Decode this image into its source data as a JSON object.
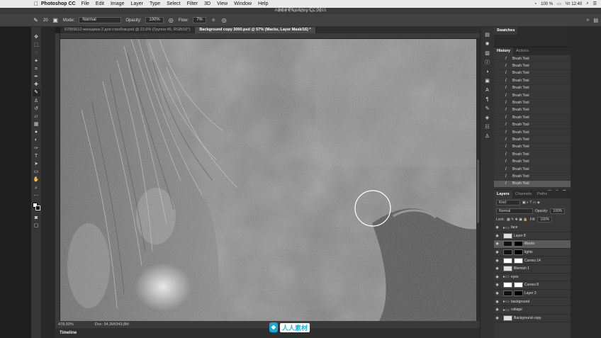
{
  "menubar": {
    "app": "Photoshop CC",
    "items": [
      "File",
      "Edit",
      "Image",
      "Layer",
      "Type",
      "Select",
      "Filter",
      "3D",
      "View",
      "Window",
      "Help"
    ],
    "battery": "100 %",
    "clock": "Чт 12:40"
  },
  "window_title": "Adobe Photoshop CC 2015",
  "options": {
    "brush_size": "20",
    "mode_label": "Mode:",
    "mode_value": "Normal",
    "opacity_label": "Opacity:",
    "opacity_value": "100%",
    "flow_label": "Flow:",
    "flow_value": "7%"
  },
  "tabs": [
    {
      "label": "67069612-женщина-3 для стиобов.psd @ 22,6% (Группа 45, RGB/16*)",
      "active": false
    },
    {
      "label": "Background copy 3000.psd @ 57% (Macks, Layer Mask/16) *",
      "active": true
    }
  ],
  "status": {
    "zoom": "478,93%",
    "doc": "Doc: 34,3M/343,8M"
  },
  "timeline_label": "Timeline",
  "watermark": {
    "top": "RRCG.CN",
    "text": "人人素材"
  },
  "panels": {
    "swatches_tab": "Swatches",
    "history_tabs": [
      "History",
      "Actions"
    ],
    "history_items": [
      "Brush Tool",
      "Brush Tool",
      "Brush Tool",
      "Brush Tool",
      "Brush Tool",
      "Brush Tool",
      "Brush Tool",
      "Brush Tool",
      "Brush Tool",
      "Brush Tool",
      "Brush Tool",
      "Brush Tool",
      "Brush Tool",
      "Brush Tool",
      "Brush Tool",
      "Brush Tool",
      "Brush Tool",
      "Brush Tool"
    ],
    "layers_tabs": [
      "Layers",
      "Channels",
      "Paths"
    ],
    "kind_label": "Kind",
    "blend_mode": "Normal",
    "opacity_label": "Opacity:",
    "opacity_value": "100%",
    "lock_label": "Lock:",
    "fill_label": "Fill:",
    "fill_value": "100%",
    "layers": [
      {
        "name": "face",
        "kind": "folder",
        "active": false
      },
      {
        "name": "Layer 8",
        "kind": "layer",
        "active": false
      },
      {
        "name": "Macks",
        "kind": "mask",
        "active": true
      },
      {
        "name": "lights",
        "kind": "mask",
        "active": false
      },
      {
        "name": "Curves 14",
        "kind": "adjust",
        "active": false
      },
      {
        "name": "Blemish 1",
        "kind": "layer",
        "active": false
      },
      {
        "name": "eyes",
        "kind": "folder",
        "active": false
      },
      {
        "name": "Curves 8",
        "kind": "adjust",
        "active": false
      },
      {
        "name": "Layer 3",
        "kind": "mask",
        "active": false
      },
      {
        "name": "background",
        "kind": "folder",
        "active": false
      },
      {
        "name": "collage",
        "kind": "folder",
        "active": false
      },
      {
        "name": "Background copy",
        "kind": "layer",
        "active": false
      }
    ]
  },
  "colors": {
    "accent": "#19a7d8",
    "panel": "#383838",
    "canvas_bg": "#7d7d7d"
  }
}
